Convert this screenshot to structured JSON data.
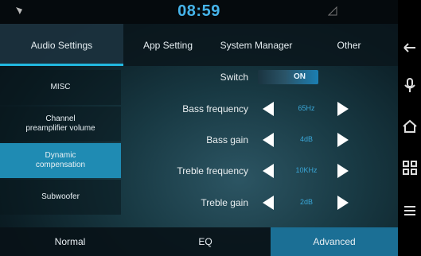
{
  "status": {
    "time": "08:59"
  },
  "tabs": [
    "Audio Settings",
    "App Setting",
    "System Manager",
    "Other"
  ],
  "active_tab": 0,
  "sidebar": {
    "items": [
      {
        "label": "MISC"
      },
      {
        "label": "Channel\npreamplifier volume"
      },
      {
        "label": "Dynamic\ncompensation"
      },
      {
        "label": "Subwoofer"
      }
    ],
    "active_index": 2
  },
  "settings": {
    "switch": {
      "label": "Switch",
      "value": "ON"
    },
    "bass_frequency": {
      "label": "Bass frequency",
      "value": "65Hz"
    },
    "bass_gain": {
      "label": "Bass gain",
      "value": "4dB"
    },
    "treble_frequency": {
      "label": "Treble frequency",
      "value": "10KHz"
    },
    "treble_gain": {
      "label": "Treble gain",
      "value": "2dB"
    }
  },
  "bottom_tabs": [
    "Normal",
    "EQ",
    "Advanced"
  ],
  "active_bottom_tab": 2,
  "colors": {
    "accent": "#46b4ea",
    "active_bg": "#1f8bb3"
  },
  "nav_icons": [
    "back-icon",
    "mic-icon",
    "home-icon",
    "apps-icon",
    "recent-icon"
  ]
}
